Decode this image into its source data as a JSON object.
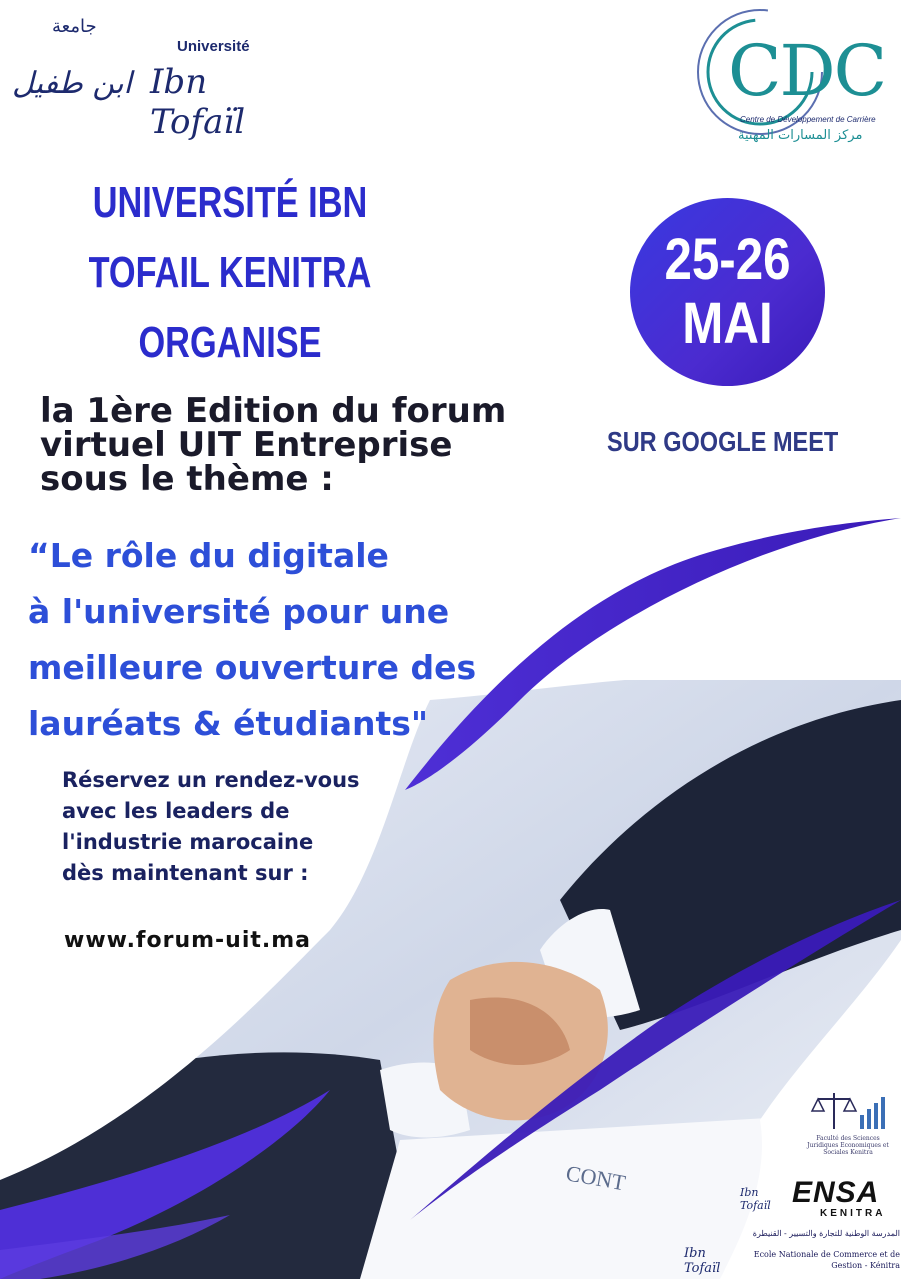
{
  "logos": {
    "uit": {
      "arabic_top": "جامعة",
      "arabic_name": "ابن طفيل",
      "univ": "Université",
      "name": "Ibn Tofaïl"
    },
    "cdc": {
      "letters": "CDC",
      "subtitle": "Centre de Développement de Carrière",
      "arabic": "مركز المسارات المهنية"
    },
    "ensa": {
      "name": "ENSA",
      "city": "KENITRA"
    },
    "fsjes": {
      "text": "Faculté des Sciences Juridiques Economiques et Sociales Kenitra"
    },
    "encg": {
      "arabic": "المدرسة الوطنية للتجارة والتسيير - القنيطرة",
      "french": "Ecole Nationale de Commerce et de Gestion - Kénitra"
    }
  },
  "headline": {
    "line1": "UNIVERSITÉ IBN",
    "line2": "TOFAIL KENITRA",
    "line3": "ORGANISE"
  },
  "date": {
    "days": "25-26",
    "month": "MAI"
  },
  "platform": "SUR GOOGLE MEET",
  "edition": {
    "line1": "la 1ère Edition du forum",
    "line2": "virtuel UIT Entreprise",
    "line3": "sous le thème :"
  },
  "theme": {
    "line1": "“Le rôle du digitale",
    "line2": "à l'université pour une",
    "line3": "meilleure ouverture des",
    "line4": "lauréats & étudiants\""
  },
  "reserve": {
    "line1": "Réservez un rendez-vous",
    "line2": "avec les leaders de",
    "line3": "l'industrie marocaine",
    "line4": "dès maintenant sur :"
  },
  "url": "www.forum-uit.ma",
  "colors": {
    "primary_blue": "#2b2ccc",
    "purple": "#3a1bb8",
    "navy": "#1d2a6e",
    "teal": "#1d8f94"
  }
}
